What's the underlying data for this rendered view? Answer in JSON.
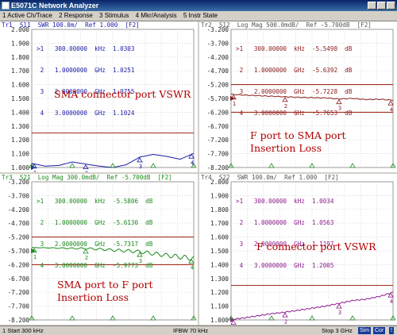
{
  "window": {
    "title": "E5071C Network Analyzer"
  },
  "menu": [
    "1 Active Ch/Trace",
    "2 Response",
    "3 Stimulus",
    "4 Mkr/Analysis",
    "5 Instr State"
  ],
  "panels": [
    {
      "id": "tr1",
      "header": "Tr1  S11  SWR 100.0m/  Ref 1.000  [F2]",
      "trace_tag": "Tr1",
      "header_rest": "  S11  SWR 100.0m/  Ref 1.000  [F2]",
      "color": "#1a1aa8",
      "yticks": [
        "2.000",
        "1.900",
        "1.800",
        "1.700",
        "1.600",
        "1.500",
        "1.400",
        "1.300",
        "1.200",
        "1.100",
        "1.000"
      ],
      "ylim": [
        1.0,
        2.0
      ],
      "limit_lines": [
        1.25
      ],
      "markers": [
        ">1   300.00000  kHz  1.0303",
        " 2   1.0000000  GHz  1.0251",
        " 3   2.0000000  GHz  1.0755",
        " 4   3.0000000  GHz  1.1024"
      ],
      "annotation": "SMA connector port VSWR"
    },
    {
      "id": "tr2",
      "header": "Tr2  S12  Log Mag 500.0mdB/  Ref -5.700dB  [F2]",
      "color": "#8b1a1a",
      "yticks": [
        "-3.200",
        "-3.700",
        "-4.200",
        "-4.700",
        "-5.200",
        "-5.700",
        "-6.200",
        "-6.700",
        "-7.200",
        "-7.700",
        "-8.200"
      ],
      "ylim": [
        -8.2,
        -3.2
      ],
      "limit_lines": [
        -5.2,
        -6.2
      ],
      "markers": [
        ">1   300.00000  kHz  -5.5498  dB",
        " 2   1.0000000  GHz  -5.6392  dB",
        " 3   2.0000000  GHz  -5.7228  dB",
        " 4   3.0000000  GHz  -5.7653  dB"
      ],
      "annotation": "F port to SMA port\nInsertion Loss"
    },
    {
      "id": "tr3",
      "header": "Tr3  S21  Log Mag 300.0mdB/  Ref -5.700dB  [F2]",
      "color": "#1a8a1a",
      "yticks": [
        "-3.200",
        "-3.700",
        "-4.200",
        "-4.700",
        "-5.200",
        "-5.700",
        "-6.200",
        "-6.700",
        "-7.200",
        "-7.700",
        "-8.200"
      ],
      "ylim": [
        -8.2,
        -3.2
      ],
      "limit_lines": [
        -5.2,
        -6.2
      ],
      "markers": [
        ">1   300.00000  kHz  -5.5806  dB",
        " 2   1.0000000  GHz  -5.6130  dB",
        " 3   2.0000000  GHz  -5.7317  dB",
        " 4   3.0000000  GHz  -5.9773  dB"
      ],
      "annotation": "SMA port to F port\nInsertion Loss"
    },
    {
      "id": "tr4",
      "header": "Tr4  S22  SWR 100.0m/  Ref 1.000  [F2]",
      "color": "#8a1a8a",
      "yticks": [
        "2.000",
        "1.900",
        "1.800",
        "1.700",
        "1.600",
        "1.500",
        "1.400",
        "1.300",
        "1.200",
        "1.100",
        "1.000"
      ],
      "ylim": [
        1.0,
        2.0
      ],
      "limit_lines": [
        1.25
      ],
      "markers": [
        ">1   300.00000  kHz  1.0034",
        " 2   1.0000000  GHz  1.0563",
        " 3   2.0000000  GHz  1.1197",
        " 4   3.0000000  GHz  1.2005"
      ],
      "annotation": "F connector port VSWR"
    }
  ],
  "chart_data": [
    {
      "type": "line",
      "trace": "Tr1 S11",
      "x_unit": "GHz",
      "xlim": [
        0.0003,
        3
      ],
      "ylim": [
        1.0,
        2.0
      ],
      "x": [
        0.0003,
        0.25,
        0.5,
        0.75,
        1.0,
        1.25,
        1.5,
        1.75,
        2.0,
        2.25,
        2.5,
        2.75,
        3.0
      ],
      "y": [
        1.03,
        1.01,
        1.015,
        1.04,
        1.025,
        1.01,
        1.0,
        1.02,
        1.075,
        1.095,
        1.08,
        1.06,
        1.102
      ]
    },
    {
      "type": "line",
      "trace": "Tr2 S12",
      "x_unit": "GHz",
      "xlim": [
        0.0003,
        3
      ],
      "ylim": [
        -8.2,
        -3.2
      ],
      "x": [
        0.0003,
        0.25,
        0.5,
        0.75,
        1.0,
        1.25,
        1.5,
        1.75,
        2.0,
        2.25,
        2.5,
        2.75,
        3.0
      ],
      "y": [
        -5.55,
        -5.58,
        -5.6,
        -5.62,
        -5.64,
        -5.66,
        -5.67,
        -5.68,
        -5.72,
        -5.7,
        -5.74,
        -5.73,
        -5.765
      ]
    },
    {
      "type": "line",
      "trace": "Tr3 S21",
      "x_unit": "GHz",
      "xlim": [
        0.0003,
        3
      ],
      "ylim": [
        -8.2,
        -3.2
      ],
      "x": [
        0.0003,
        0.25,
        0.5,
        0.75,
        1.0,
        1.25,
        1.5,
        1.75,
        2.0,
        2.25,
        2.5,
        2.75,
        3.0
      ],
      "y": [
        -5.58,
        -5.59,
        -5.6,
        -5.61,
        -5.613,
        -5.64,
        -5.67,
        -5.7,
        -5.73,
        -5.8,
        -5.86,
        -5.92,
        -5.977
      ]
    },
    {
      "type": "line",
      "trace": "Tr4 S22",
      "x_unit": "GHz",
      "xlim": [
        0.0003,
        3
      ],
      "ylim": [
        1.0,
        2.0
      ],
      "x": [
        0.0003,
        0.25,
        0.5,
        0.75,
        1.0,
        1.25,
        1.5,
        1.75,
        2.0,
        2.25,
        2.5,
        2.75,
        3.0
      ],
      "y": [
        1.003,
        1.015,
        1.03,
        1.045,
        1.056,
        1.07,
        1.085,
        1.1,
        1.12,
        1.14,
        1.15,
        1.17,
        1.2
      ]
    }
  ],
  "status": {
    "left": "1  Start 300 kHz",
    "mid": "IFBW 70 kHz",
    "right": "Stop 3 GHz",
    "btn1": "Sim",
    "btn2": "Cor",
    "btn3": "!"
  }
}
